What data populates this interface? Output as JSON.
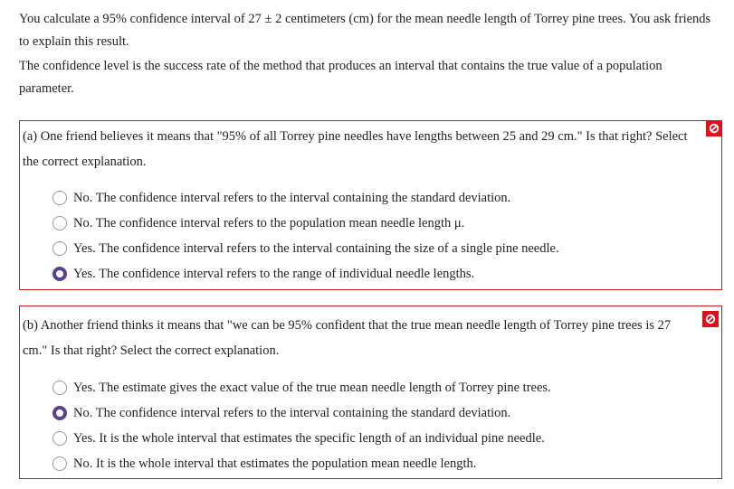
{
  "intro": {
    "paragraph1": "You calculate a 95% confidence interval of 27 ± 2 centimeters (cm) for the mean needle length of Torrey pine trees. You ask friends to explain this result.",
    "paragraph2": "The confidence level is the success rate of the method that produces an interval that contains the true value of a population parameter."
  },
  "questions": [
    {
      "prompt": "(a) One friend believes it means that \"95% of all Torrey pine needles have lengths between 25 and 29 cm.\" Is that right? Select the correct explanation.",
      "status_icon": "incorrect-icon",
      "status_color": "#e0101a",
      "selected_index": 3,
      "options": [
        {
          "label": "No. The confidence interval refers to the interval containing the standard deviation."
        },
        {
          "label": "No. The confidence interval refers to the population mean needle length μ."
        },
        {
          "label": "Yes. The confidence interval refers to the interval containing the size of a single pine needle."
        },
        {
          "label": "Yes. The confidence interval refers to the range of individual needle lengths."
        }
      ]
    },
    {
      "prompt": "(b) Another friend thinks it means that \"we can be 95% confident that the true mean needle length of Torrey pine trees is 27 cm.\" Is that right? Select the correct explanation.",
      "status_icon": "incorrect-icon",
      "status_color": "#e0101a",
      "selected_index": 1,
      "options": [
        {
          "label": "Yes. The estimate gives the exact value of the true mean needle length of Torrey pine trees."
        },
        {
          "label": "No. The confidence interval refers to the interval containing the standard deviation."
        },
        {
          "label": "Yes. It is the whole interval that estimates the specific length of an individual pine needle."
        },
        {
          "label": "No. It is the whole interval that estimates the population mean needle length."
        }
      ]
    }
  ],
  "colors": {
    "error_border": "#c81818",
    "radio_selected": "#5b3f8f"
  }
}
